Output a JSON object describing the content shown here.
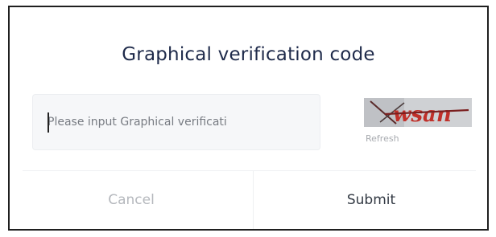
{
  "dialog": {
    "title": "Graphical verification code",
    "input": {
      "value": "",
      "placeholder": "Please input Graphical verificati"
    },
    "captcha": {
      "text": "wsan",
      "refresh_label": "Refresh"
    },
    "cancel_label": "Cancel",
    "submit_label": "Submit"
  },
  "colors": {
    "title": "#1e2a4a",
    "captcha_text": "#c0302a",
    "captcha_bg": "#c9cbcf",
    "muted": "#b5b8bd"
  }
}
